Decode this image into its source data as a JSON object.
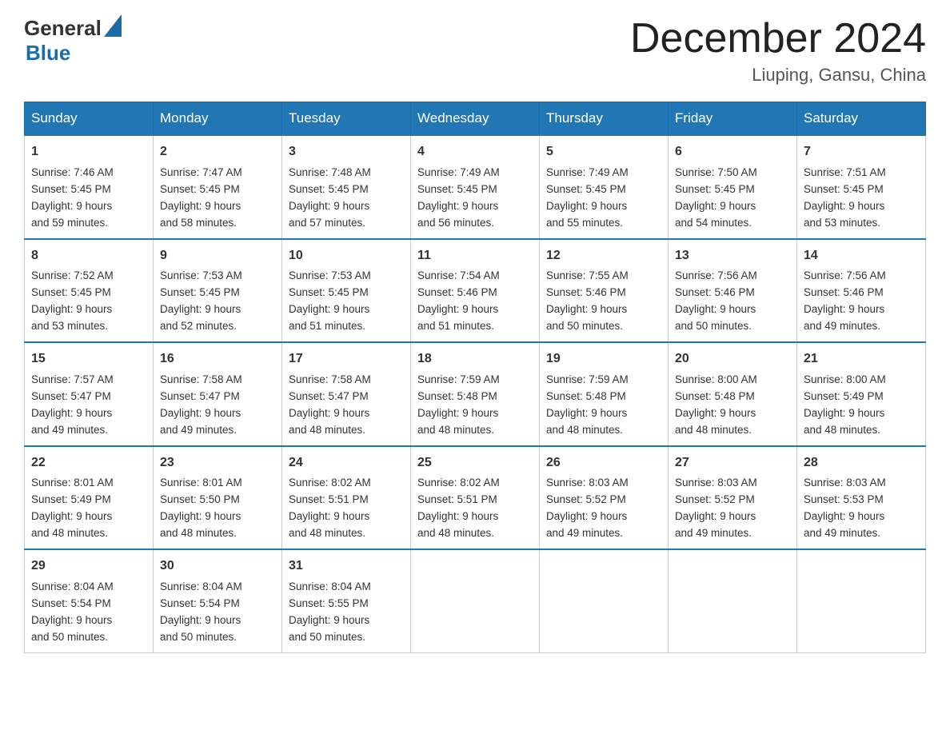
{
  "header": {
    "logo_line1": "General",
    "logo_line2": "Blue",
    "month_title": "December 2024",
    "location": "Liuping, Gansu, China"
  },
  "days_of_week": [
    "Sunday",
    "Monday",
    "Tuesday",
    "Wednesday",
    "Thursday",
    "Friday",
    "Saturday"
  ],
  "weeks": [
    [
      {
        "day": "1",
        "sunrise": "7:46 AM",
        "sunset": "5:45 PM",
        "daylight": "9 hours and 59 minutes."
      },
      {
        "day": "2",
        "sunrise": "7:47 AM",
        "sunset": "5:45 PM",
        "daylight": "9 hours and 58 minutes."
      },
      {
        "day": "3",
        "sunrise": "7:48 AM",
        "sunset": "5:45 PM",
        "daylight": "9 hours and 57 minutes."
      },
      {
        "day": "4",
        "sunrise": "7:49 AM",
        "sunset": "5:45 PM",
        "daylight": "9 hours and 56 minutes."
      },
      {
        "day": "5",
        "sunrise": "7:49 AM",
        "sunset": "5:45 PM",
        "daylight": "9 hours and 55 minutes."
      },
      {
        "day": "6",
        "sunrise": "7:50 AM",
        "sunset": "5:45 PM",
        "daylight": "9 hours and 54 minutes."
      },
      {
        "day": "7",
        "sunrise": "7:51 AM",
        "sunset": "5:45 PM",
        "daylight": "9 hours and 53 minutes."
      }
    ],
    [
      {
        "day": "8",
        "sunrise": "7:52 AM",
        "sunset": "5:45 PM",
        "daylight": "9 hours and 53 minutes."
      },
      {
        "day": "9",
        "sunrise": "7:53 AM",
        "sunset": "5:45 PM",
        "daylight": "9 hours and 52 minutes."
      },
      {
        "day": "10",
        "sunrise": "7:53 AM",
        "sunset": "5:45 PM",
        "daylight": "9 hours and 51 minutes."
      },
      {
        "day": "11",
        "sunrise": "7:54 AM",
        "sunset": "5:46 PM",
        "daylight": "9 hours and 51 minutes."
      },
      {
        "day": "12",
        "sunrise": "7:55 AM",
        "sunset": "5:46 PM",
        "daylight": "9 hours and 50 minutes."
      },
      {
        "day": "13",
        "sunrise": "7:56 AM",
        "sunset": "5:46 PM",
        "daylight": "9 hours and 50 minutes."
      },
      {
        "day": "14",
        "sunrise": "7:56 AM",
        "sunset": "5:46 PM",
        "daylight": "9 hours and 49 minutes."
      }
    ],
    [
      {
        "day": "15",
        "sunrise": "7:57 AM",
        "sunset": "5:47 PM",
        "daylight": "9 hours and 49 minutes."
      },
      {
        "day": "16",
        "sunrise": "7:58 AM",
        "sunset": "5:47 PM",
        "daylight": "9 hours and 49 minutes."
      },
      {
        "day": "17",
        "sunrise": "7:58 AM",
        "sunset": "5:47 PM",
        "daylight": "9 hours and 48 minutes."
      },
      {
        "day": "18",
        "sunrise": "7:59 AM",
        "sunset": "5:48 PM",
        "daylight": "9 hours and 48 minutes."
      },
      {
        "day": "19",
        "sunrise": "7:59 AM",
        "sunset": "5:48 PM",
        "daylight": "9 hours and 48 minutes."
      },
      {
        "day": "20",
        "sunrise": "8:00 AM",
        "sunset": "5:48 PM",
        "daylight": "9 hours and 48 minutes."
      },
      {
        "day": "21",
        "sunrise": "8:00 AM",
        "sunset": "5:49 PM",
        "daylight": "9 hours and 48 minutes."
      }
    ],
    [
      {
        "day": "22",
        "sunrise": "8:01 AM",
        "sunset": "5:49 PM",
        "daylight": "9 hours and 48 minutes."
      },
      {
        "day": "23",
        "sunrise": "8:01 AM",
        "sunset": "5:50 PM",
        "daylight": "9 hours and 48 minutes."
      },
      {
        "day": "24",
        "sunrise": "8:02 AM",
        "sunset": "5:51 PM",
        "daylight": "9 hours and 48 minutes."
      },
      {
        "day": "25",
        "sunrise": "8:02 AM",
        "sunset": "5:51 PM",
        "daylight": "9 hours and 48 minutes."
      },
      {
        "day": "26",
        "sunrise": "8:03 AM",
        "sunset": "5:52 PM",
        "daylight": "9 hours and 49 minutes."
      },
      {
        "day": "27",
        "sunrise": "8:03 AM",
        "sunset": "5:52 PM",
        "daylight": "9 hours and 49 minutes."
      },
      {
        "day": "28",
        "sunrise": "8:03 AM",
        "sunset": "5:53 PM",
        "daylight": "9 hours and 49 minutes."
      }
    ],
    [
      {
        "day": "29",
        "sunrise": "8:04 AM",
        "sunset": "5:54 PM",
        "daylight": "9 hours and 50 minutes."
      },
      {
        "day": "30",
        "sunrise": "8:04 AM",
        "sunset": "5:54 PM",
        "daylight": "9 hours and 50 minutes."
      },
      {
        "day": "31",
        "sunrise": "8:04 AM",
        "sunset": "5:55 PM",
        "daylight": "9 hours and 50 minutes."
      },
      null,
      null,
      null,
      null
    ]
  ],
  "labels": {
    "sunrise": "Sunrise:",
    "sunset": "Sunset:",
    "daylight": "Daylight:"
  }
}
